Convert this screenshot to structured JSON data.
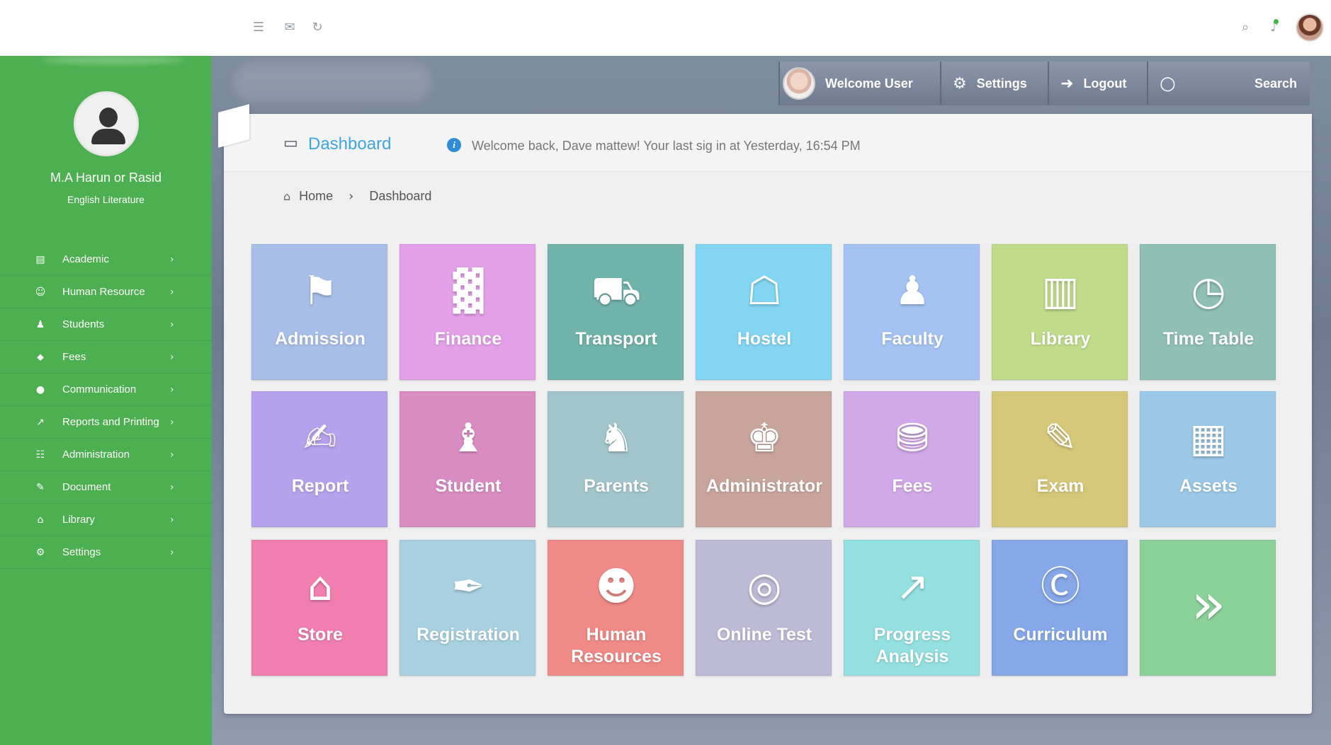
{
  "profile": {
    "name": "M.A Harun or Rasid",
    "subtitle": "English Literature"
  },
  "sidebar": {
    "items": [
      {
        "label": "Academic",
        "icon": "book-icon",
        "glyph": "▤"
      },
      {
        "label": "Human Resource",
        "icon": "head-icon",
        "glyph": "☺"
      },
      {
        "label": "Students",
        "icon": "reader-icon",
        "glyph": "♟"
      },
      {
        "label": "Fees",
        "icon": "money-icon",
        "glyph": "⬥"
      },
      {
        "label": "Communication",
        "icon": "chat-icon",
        "glyph": "●"
      },
      {
        "label": "Reports and Printing",
        "icon": "chart-icon",
        "glyph": "↗"
      },
      {
        "label": "Administration",
        "icon": "document-icon",
        "glyph": "☷"
      },
      {
        "label": "Document",
        "icon": "edit-icon",
        "glyph": "✎"
      },
      {
        "label": "Library",
        "icon": "institution-icon",
        "glyph": "⌂"
      },
      {
        "label": "Settings",
        "icon": "gear-icon",
        "glyph": "⚙"
      }
    ],
    "chevron": "›"
  },
  "header": {
    "welcome": "Welcome User",
    "settings": "Settings",
    "logout": "Logout",
    "search": "Search",
    "settings_glyph": "⚙",
    "logout_glyph": "➜",
    "search_glyph": "○"
  },
  "topbar": {
    "menu_glyph": "☰",
    "mail_glyph": "✉",
    "refresh_glyph": "↻",
    "search_glyph": "⌕",
    "bell_glyph": "♪"
  },
  "panel": {
    "title": "Dashboard",
    "title_glyph": "▭",
    "info_glyph": "i",
    "welcome_message": "Welcome back,  Dave mattew!  Your last sig in at Yesterday, 16:54 PM",
    "breadcrumb": {
      "home": "Home",
      "separator": "›",
      "current": "Dashboard",
      "home_glyph": "⌂"
    }
  },
  "tiles": [
    {
      "label": "Admission",
      "color": "#a7bfe8",
      "icon": "admission-icon",
      "glyph": "⚑"
    },
    {
      "label": "Finance",
      "color": "#e39fe8",
      "icon": "finance-chart-icon",
      "glyph": "▓"
    },
    {
      "label": "Transport",
      "color": "#6fb3ab",
      "icon": "bus-icon",
      "glyph": "⛟"
    },
    {
      "label": "Hostel",
      "color": "#82d6f3",
      "icon": "building-icon",
      "glyph": "☖"
    },
    {
      "label": "Faculty",
      "color": "#a5c3f2",
      "icon": "faculty-icon",
      "glyph": "♟"
    },
    {
      "label": "Library",
      "color": "#bedc8a",
      "icon": "books-icon",
      "glyph": "▥"
    },
    {
      "label": "Time Table",
      "color": "#8fbfb5",
      "icon": "calendar-clock-icon",
      "glyph": "◷"
    },
    {
      "label": "Report",
      "color": "#b6a2ec",
      "icon": "clipboard-icon",
      "glyph": "✍"
    },
    {
      "label": "Student",
      "color": "#d98cc2",
      "icon": "student-icon",
      "glyph": "♝"
    },
    {
      "label": "Parents",
      "color": "#a2c5cc",
      "icon": "parents-icon",
      "glyph": "♞"
    },
    {
      "label": "Administrator",
      "color": "#c8a59c",
      "icon": "administrator-icon",
      "glyph": "♚"
    },
    {
      "label": "Fees",
      "color": "#d1a8e8",
      "icon": "coins-icon",
      "glyph": "⛃"
    },
    {
      "label": "Exam",
      "color": "#d6c778",
      "icon": "exam-icon",
      "glyph": "✎"
    },
    {
      "label": "Assets",
      "color": "#9bc8e6",
      "icon": "assets-icon",
      "glyph": "▦"
    },
    {
      "label": "Store",
      "color": "#f07fb0",
      "icon": "store-icon",
      "glyph": "⌂"
    },
    {
      "label": "Registration",
      "color": "#a8d0e0",
      "icon": "registration-icon",
      "glyph": "✒"
    },
    {
      "label": "Human Resources",
      "color": "#f08a86",
      "icon": "people-icon",
      "glyph": "☻"
    },
    {
      "label": "Online Test",
      "color": "#bdbad6",
      "icon": "globe-icon",
      "glyph": "◎"
    },
    {
      "label": "Progress Analysis",
      "color": "#94e0e0",
      "icon": "growth-chart-icon",
      "glyph": "↗"
    },
    {
      "label": "Curriculum",
      "color": "#86a8e8",
      "icon": "cv-icon",
      "glyph": "Ⓒ"
    },
    {
      "label": "",
      "color": "#8ad29a",
      "icon": "double-arrow-icon",
      "glyph": "»"
    }
  ]
}
